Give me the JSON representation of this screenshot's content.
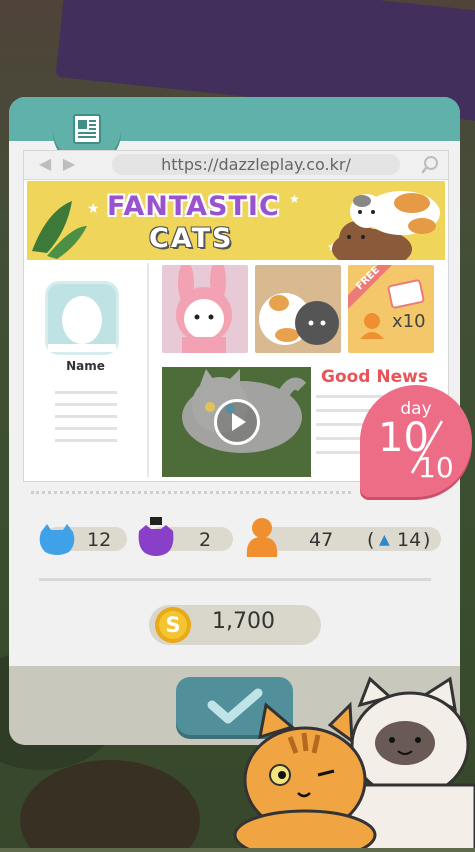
{
  "browser": {
    "url": "https://dazzleplay.co.kr/",
    "back_icon": "arrow-left-icon",
    "forward_icon": "arrow-right-icon",
    "search_icon": "magnifier-icon"
  },
  "banner": {
    "line1": "FANTASTIC",
    "line2": "CATS"
  },
  "profile": {
    "name": "Name"
  },
  "thumbnails": {
    "free_tag": "FREE",
    "reward_count": "x10"
  },
  "news": {
    "headline": "Good News"
  },
  "day_badge": {
    "label": "day",
    "current": "10",
    "total": "10"
  },
  "stats": {
    "cats": "12",
    "purple": "2",
    "visitors": "47",
    "visitors_delta_open": "(",
    "visitors_delta_icon": "▲",
    "visitors_delta": "14",
    "visitors_delta_close": ")"
  },
  "coins": {
    "symbol": "S",
    "amount": "1,700"
  },
  "colors": {
    "teal": "#5fb1aa",
    "pink": "#ee6d86",
    "banner_yellow": "#f0d55b",
    "button": "#51909b"
  }
}
